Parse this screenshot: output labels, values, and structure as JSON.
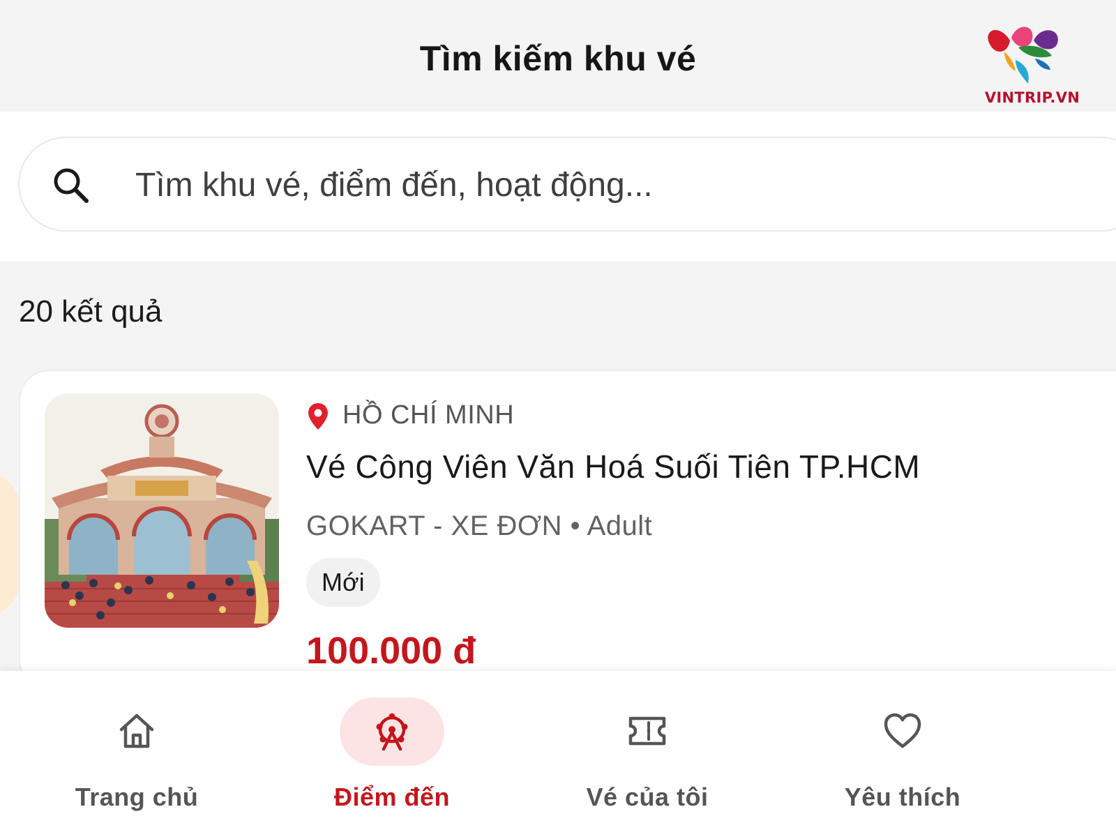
{
  "header": {
    "title": "Tìm kiếm khu vé",
    "logo_text": "VINTRIP.VN"
  },
  "search": {
    "placeholder": "Tìm khu vé, điểm đến, hoạt động...",
    "icon": "search-icon"
  },
  "results": {
    "count_label": "20 kết quả"
  },
  "items": [
    {
      "location": "HỒ CHÍ MINH",
      "title": "Vé Công Viên Văn Hoá Suối Tiên TP.HCM",
      "subtitle": "GOKART - XE ĐƠN • Adult",
      "badge": "Mới",
      "price": "100.000 đ"
    }
  ],
  "bottom_nav": {
    "items": [
      {
        "label": "Trang chủ",
        "icon": "home-icon",
        "active": false
      },
      {
        "label": "Điểm đến",
        "icon": "ferris-wheel-icon",
        "active": true
      },
      {
        "label": "Vé của tôi",
        "icon": "ticket-icon",
        "active": false
      },
      {
        "label": "Yêu thích",
        "icon": "heart-icon",
        "active": false
      }
    ]
  },
  "colors": {
    "accent": "#c4161c",
    "active_nav_bg": "#fde4e4",
    "background": "#f4f4f4"
  }
}
